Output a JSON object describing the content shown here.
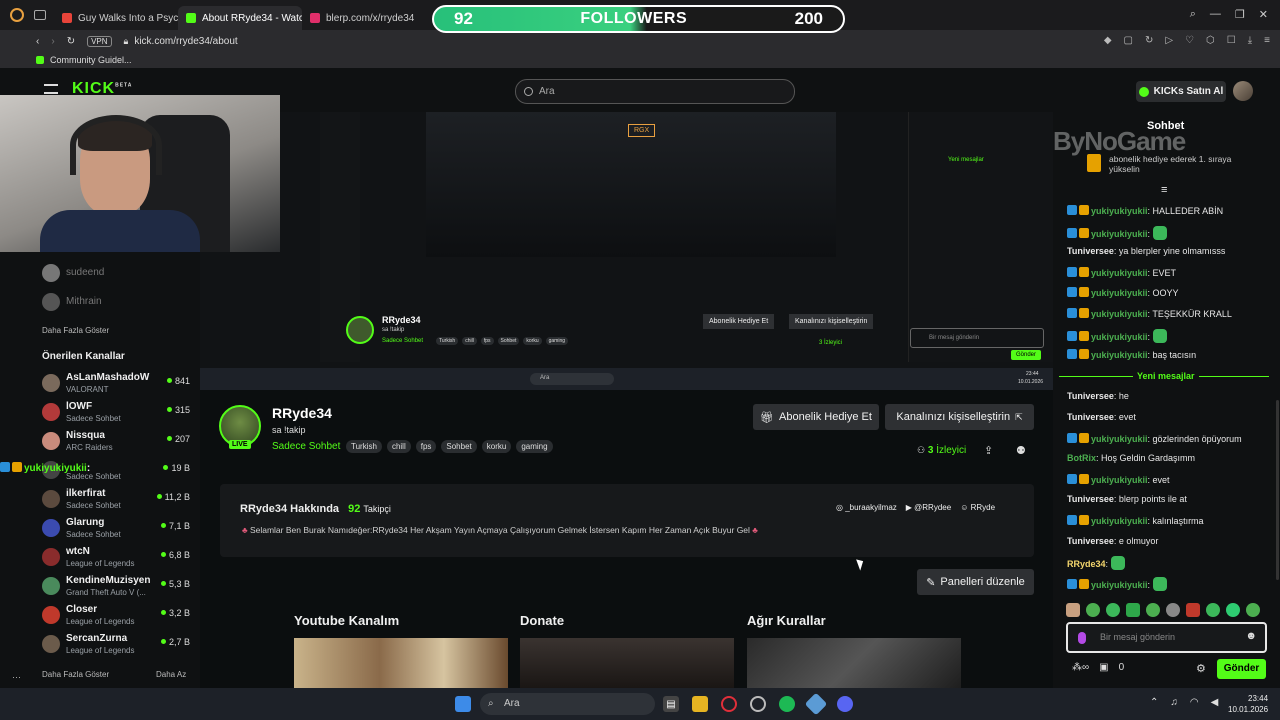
{
  "browser": {
    "tabs": [
      {
        "label": "Guy Walks Into a Psychiatrist",
        "color": "#e8443a"
      },
      {
        "label": "About RRyde34 - Watch Li",
        "color": "#53fc18"
      },
      {
        "label": "blerp.com/x/rryde34",
        "color": "#e02f6a"
      }
    ],
    "url": "kick.com/rryde34/about",
    "vpn_label": "VPN",
    "bookmark": "Community Guidel..."
  },
  "overlay": {
    "left_count": "92",
    "label": "FOLLOWERS",
    "right_count": "200",
    "watermark": "ByNoGame"
  },
  "header": {
    "logo": "KICK",
    "beta": "BETA",
    "search_placeholder": "Ara",
    "buy_label": "KICKs Satın Al"
  },
  "sidebar": {
    "top_users": [
      {
        "name": "sudeend"
      },
      {
        "name": "Mithrain"
      }
    ],
    "show_more_top": "Daha Fazla Göster",
    "section_title": "Önerilen Kanallar",
    "channels": [
      {
        "name": "AsLanMashadoW",
        "sub": "VALORANT",
        "count": "841",
        "color": "#7a6a5c"
      },
      {
        "name": "lOWF",
        "sub": "Sadece Sohbet",
        "count": "315",
        "color": "#b23a3a"
      },
      {
        "name": "Nissqua",
        "sub": "ARC Raiders",
        "count": "207",
        "color": "#c98b7c"
      },
      {
        "name": "Hype",
        "sub": "Sadece Sohbet",
        "count": "19 B",
        "color": "#444"
      },
      {
        "name": "ilkerfirat",
        "sub": "Sadece Sohbet",
        "count": "11,2 B",
        "color": "#5b4a3e"
      },
      {
        "name": "Glarung",
        "sub": "Sadece Sohbet",
        "count": "7,1 B",
        "color": "#3b4bb0"
      },
      {
        "name": "wtcN",
        "sub": "League of Legends",
        "count": "6,8 B",
        "color": "#8a2c2c"
      },
      {
        "name": "KendineMuzisyen",
        "sub": "Grand Theft Auto V (...",
        "count": "5,3 B",
        "color": "#4a8a5c"
      },
      {
        "name": "Closer",
        "sub": "League of Legends",
        "count": "3,2 B",
        "color": "#c0392b"
      },
      {
        "name": "SercanZurna",
        "sub": "League of Legends",
        "count": "2,7 B",
        "color": "#6b5b4b"
      }
    ],
    "show_more": "Daha Fazla Göster",
    "show_less": "Daha Az",
    "overlay_chat_user": "yukiyukiyukii",
    "overlay_chat_sep": ":"
  },
  "stream": {
    "inner_channel": "RRyde34",
    "inner_title": "sa !takip",
    "inner_category": "Sadece Sohbet",
    "inner_tags": [
      "Turkish",
      "chill",
      "fps",
      "Sohbet",
      "korku",
      "gaming"
    ],
    "inner_gift": "Abonelik Hediye Et",
    "inner_custom": "Kanalınızı kişiselleştirin",
    "inner_viewers": "3 İzleyici",
    "inner_search": "Ara",
    "inner_clock": "23:44",
    "inner_date": "10.01.2026",
    "inner_chat_placeholder": "Bir mesaj gönderin",
    "inner_send": "Gönder",
    "inner_new": "Yeni mesajlar",
    "inner_rgx": "RGX"
  },
  "channel": {
    "name": "RRyde34",
    "title": "sa !takip",
    "category": "Sadece Sohbet",
    "live": "LIVE",
    "tags": [
      "Turkish",
      "chill",
      "fps",
      "Sohbet",
      "korku",
      "gaming"
    ],
    "gift_button": "Abonelik Hediye Et",
    "customize_button": "Kanalınızı kişiselleştirin",
    "viewers_count": "3",
    "viewers_label": "İzleyici",
    "about_title": "RRyde34 Hakkında",
    "followers_count": "92",
    "followers_label": "Takipçi",
    "socials": [
      "_buraakyilmaz",
      "@RRydee",
      "RRyde"
    ],
    "bio": "Selamlar Ben Burak Namıdeğer:RRyde34 Her Akşam Yayın Açmaya Çalışıyorum Gelmek İstersen Kapım Her Zaman Açık Buyur Gel",
    "edit_panels": "Panelleri düzenle",
    "panels": [
      "Youtube Kanalım",
      "Donate",
      "Ağır Kurallar"
    ]
  },
  "chat": {
    "title": "Sohbet",
    "top_notice": "abonelik hediye ederek 1. sıraya yükselin",
    "new_messages": "Yeni mesajlar",
    "messages": [
      {
        "user": "yukiyukiyukii",
        "text": "HALLEDER ABİN",
        "color": "#4caf50",
        "badges": true
      },
      {
        "user": "yukiyukiyukii",
        "text": "",
        "color": "#4caf50",
        "badges": true,
        "emote": true
      },
      {
        "user": "Tuniversee",
        "text": "ya blerpler yine olmamısss",
        "color": "#e8e8e8",
        "badges": false
      },
      {
        "user": "yukiyukiyukii",
        "text": "EVET",
        "color": "#4caf50",
        "badges": true
      },
      {
        "user": "yukiyukiyukii",
        "text": "OOYY",
        "color": "#4caf50",
        "badges": true
      },
      {
        "user": "yukiyukiyukii",
        "text": "TEŞEKKÜR KRALL",
        "color": "#4caf50",
        "badges": true
      },
      {
        "user": "yukiyukiyukii",
        "text": "",
        "color": "#4caf50",
        "badges": true,
        "emote": true
      },
      {
        "user": "yukiyukiyukii",
        "text": "baş tacısın",
        "color": "#4caf50",
        "badges": true
      },
      {
        "user": "Tuniversee",
        "text": "he",
        "color": "#e8e8e8",
        "badges": false
      },
      {
        "user": "Tuniversee",
        "text": "evet",
        "color": "#e8e8e8",
        "badges": false
      },
      {
        "user": "yukiyukiyukii",
        "text": "gözlerinden öpüyorum",
        "color": "#4caf50",
        "badges": true
      },
      {
        "user": "BotRix",
        "text": "Hoş Geldin Gardaşımm",
        "color": "#4caf50",
        "badges": false
      },
      {
        "user": "yukiyukiyukii",
        "text": "evet",
        "color": "#4caf50",
        "badges": true
      },
      {
        "user": "Tuniversee",
        "text": "blerp points ile at",
        "color": "#e8e8e8",
        "badges": false
      },
      {
        "user": "yukiyukiyukii",
        "text": "kalınlaştırma",
        "color": "#4caf50",
        "badges": true
      },
      {
        "user": "Tuniversee",
        "text": "e olmuyor",
        "color": "#e8e8e8",
        "badges": false
      },
      {
        "user": "RRyde34",
        "text": "",
        "color": "#f5d76e",
        "badges": false,
        "emote": true
      },
      {
        "user": "yukiyukiyukii",
        "text": "",
        "color": "#4caf50",
        "badges": true,
        "emote": true
      }
    ],
    "input_placeholder": "Bir mesaj gönderin",
    "points": "0",
    "send_label": "Gönder"
  },
  "taskbar": {
    "search": "Ara",
    "time": "23:44",
    "date": "10.01.2026"
  },
  "colors": {
    "kick_green": "#53fc18",
    "bg": "#0b0e0f",
    "panel": "#17191b"
  }
}
